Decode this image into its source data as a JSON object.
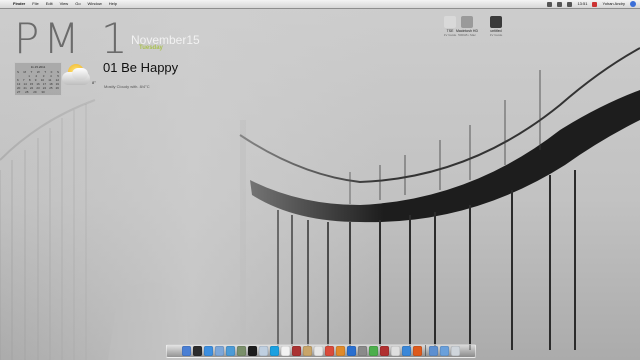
{
  "menubar": {
    "apple_glyph": "",
    "app_name": "Finder",
    "menus": [
      "File",
      "Edit",
      "View",
      "Go",
      "Window",
      "Help"
    ],
    "clock": "13:51",
    "user": "Yohan Andry"
  },
  "widgets": {
    "clock": "PM 1",
    "date": "November15",
    "weekday": "Tuesday",
    "song": "01 Be Happy",
    "calendar": {
      "title": "11.15.2011",
      "rows": [
        [
          "S",
          "M",
          "T",
          "W",
          "T",
          "F",
          "S"
        ],
        [
          "",
          "",
          "1",
          "2",
          "3",
          "4",
          "5"
        ],
        [
          "6",
          "7",
          "8",
          "9",
          "10",
          "11",
          "12"
        ],
        [
          "13",
          "14",
          "15",
          "16",
          "17",
          "18",
          "19"
        ],
        [
          "20",
          "21",
          "22",
          "23",
          "24",
          "25",
          "26"
        ],
        [
          "27",
          "28",
          "29",
          "30",
          "",
          "",
          ""
        ]
      ]
    },
    "weather": {
      "temperature": "8°",
      "location": "Mostly Cloudy with. 8/4°C"
    }
  },
  "desktop_icons": [
    {
      "name": "TSE",
      "sub": "1V Guide",
      "color": "#d9d9d9"
    },
    {
      "name": "Macintosh HD",
      "sub": "500GB • Mac",
      "color": "#9a9a9a"
    },
    {
      "name": "untitled",
      "sub": "1V Guide",
      "color": "#3a3a3a"
    }
  ],
  "dock": {
    "items": [
      {
        "name": "Finder",
        "color": "#4a7fd4"
      },
      {
        "name": "Dashboard",
        "color": "#2d2d2d"
      },
      {
        "name": "Safari",
        "color": "#3d8fe0"
      },
      {
        "name": "Mail",
        "color": "#7ea7d8"
      },
      {
        "name": "iTunes",
        "color": "#4c9bd6"
      },
      {
        "name": "iPhoto",
        "color": "#7a8f6a"
      },
      {
        "name": "Terminal",
        "color": "#1c1c1c"
      },
      {
        "name": "Preview",
        "color": "#bfcfe0"
      },
      {
        "name": "Skype",
        "color": "#1aa0e0"
      },
      {
        "name": "Calendar",
        "color": "#f2f2f2"
      },
      {
        "name": "Photo Booth",
        "color": "#a33"
      },
      {
        "name": "Address Book",
        "color": "#c8a56a"
      },
      {
        "name": "TextEdit",
        "color": "#e8e8e8"
      },
      {
        "name": "Chrome",
        "color": "#d94b3b"
      },
      {
        "name": "Firefox",
        "color": "#e08a2a"
      },
      {
        "name": "QuickTime",
        "color": "#2a6fcf"
      },
      {
        "name": "System Preferences",
        "color": "#8a8a8a"
      },
      {
        "name": "Activity Monitor",
        "color": "#4cae4c"
      },
      {
        "name": "Adobe",
        "color": "#b03030"
      },
      {
        "name": "iCal",
        "color": "#dfdfdf"
      },
      {
        "name": "App Store",
        "color": "#3a87d8"
      },
      {
        "name": "Ubuntu",
        "color": "#dd5a1c"
      }
    ],
    "stack_items": [
      {
        "name": "Applications",
        "color": "#5d8fd0"
      },
      {
        "name": "Downloads",
        "color": "#6aa0db"
      },
      {
        "name": "Trash",
        "color": "#cfd5db"
      }
    ]
  }
}
